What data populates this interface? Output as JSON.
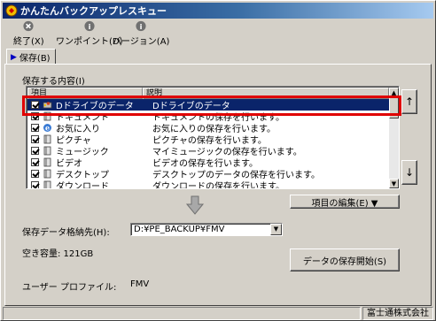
{
  "window": {
    "title": "かんたんバックアップレスキュー"
  },
  "toolbar": {
    "exit_label": "終了(X)",
    "onepoint_label": "ワンポイント(D)",
    "version_label": "バージョン(A)"
  },
  "tabs": [
    {
      "label": "保存(B)"
    }
  ],
  "backup": {
    "section_label": "保存する内容(I)",
    "columns": [
      "項目",
      "説明"
    ],
    "items": [
      {
        "name": "Dドライブのデータ",
        "description": "Dドライブのデータ",
        "checked": true,
        "selected": true,
        "icon": "drive-icon"
      },
      {
        "name": "ドキュメント",
        "description": "ドキュメントの保存を行います。",
        "checked": true,
        "selected": false,
        "icon": "book-icon"
      },
      {
        "name": "お気に入り",
        "description": "お気に入りの保存を行います。",
        "checked": true,
        "selected": false,
        "icon": "ie-favorites-icon"
      },
      {
        "name": "ピクチャ",
        "description": "ピクチャの保存を行います。",
        "checked": true,
        "selected": false,
        "icon": "book-icon"
      },
      {
        "name": "ミュージック",
        "description": "マイミュージックの保存を行います。",
        "checked": true,
        "selected": false,
        "icon": "book-icon"
      },
      {
        "name": "ビデオ",
        "description": "ビデオの保存を行います。",
        "checked": true,
        "selected": false,
        "icon": "book-icon"
      },
      {
        "name": "デスクトップ",
        "description": "デスクトップのデータの保存を行います。",
        "checked": true,
        "selected": false,
        "icon": "book-icon"
      },
      {
        "name": "ダウンロード",
        "description": "ダウンロードの保存を行います。",
        "checked": true,
        "selected": false,
        "icon": "book-icon"
      }
    ],
    "move_up_label": "↑",
    "move_down_label": "↓",
    "edit_items_label": "項目の編集(E) ▼",
    "destination_label": "保存データ格納先(H):",
    "destination_value": "D:¥PE_BACKUP¥FMV",
    "free_space_label": "空き容量: 121GB",
    "start_button_label": "データの保存開始(S)",
    "user_profile_label": "ユーザー プロファイル:",
    "user_profile_value": "FMV"
  },
  "status": {
    "company": "富士通株式会社"
  },
  "colors": {
    "title_bar": "#0a246a",
    "selection": "#0a246a",
    "highlight_box": "#e00000",
    "face": "#d4d0c8"
  }
}
